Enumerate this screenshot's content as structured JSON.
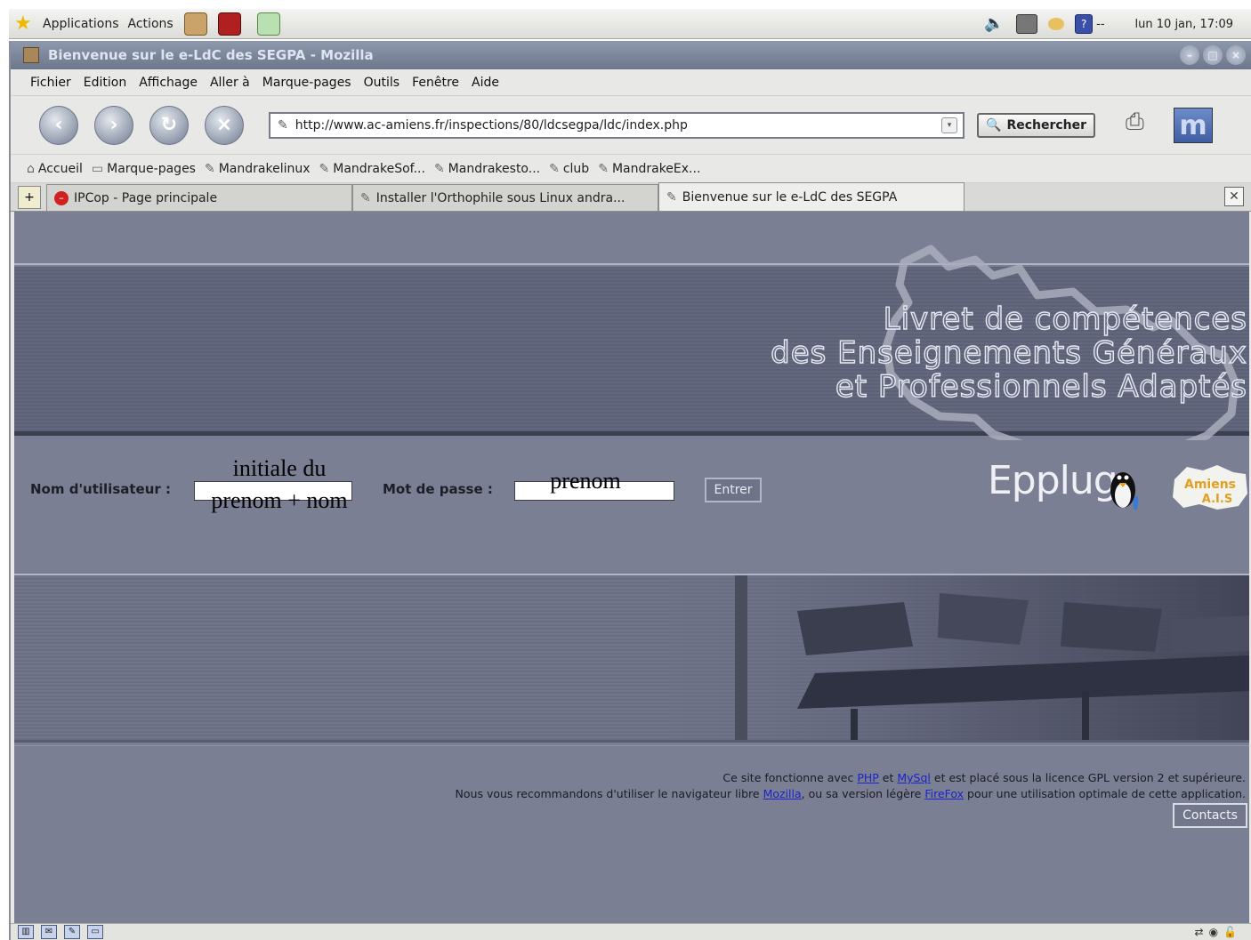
{
  "panel": {
    "menus": [
      "Applications",
      "Actions"
    ],
    "clock": "lun 10 jan, 17:09",
    "network_label": "--"
  },
  "window": {
    "title": "Bienvenue sur le e-LdC des SEGPA - Mozilla"
  },
  "menubar": [
    "Fichier",
    "Edition",
    "Affichage",
    "Aller à",
    "Marque-pages",
    "Outils",
    "Fenêtre",
    "Aide"
  ],
  "navbar": {
    "url": "http://www.ac-amiens.fr/inspections/80/ldcsegpa/ldc/index.php",
    "search_label": "Rechercher"
  },
  "bookmarks": [
    "Accueil",
    "Marque-pages",
    "Mandrakelinux",
    "MandrakeSof...",
    "Mandrakesto...",
    "club",
    "MandrakeEx..."
  ],
  "tabs": [
    {
      "label": "IPCop - Page principale"
    },
    {
      "label": "Installer l'Orthophile sous Linux andra..."
    },
    {
      "label": "Bienvenue sur le e-LdC des SEGPA"
    }
  ],
  "page": {
    "banner_lines": [
      "Livret de compétences",
      "des Enseignements Généraux",
      "et Professionnels Adaptés"
    ],
    "login": {
      "user_label": "Nom d'utilisateur :",
      "pass_label": "Mot de passe :",
      "submit_label": "Entrer",
      "user_annotation_1": "initiale du",
      "user_annotation_2": "prenom + nom",
      "pass_annotation": "prenom"
    },
    "logos": {
      "epplug": "Epplug",
      "amiens_1": "Amiens",
      "amiens_2": "A.I.S"
    },
    "footer": {
      "line1_pre": "Ce site fonctionne avec ",
      "php": "PHP",
      "et": " et ",
      "mysql": "MySql",
      "line1_post": " et est placé sous la licence GPL version 2 et supérieure.",
      "line2_pre": "Nous vous recommandons d'utiliser le navigateur libre ",
      "mozilla": "Mozilla",
      "line2_mid": ", ou sa version légère ",
      "firefox": "FireFox",
      "line2_post": " pour une utilisation optimale de cette application.",
      "contacts": "Contacts"
    }
  },
  "colors": {
    "page_bg": "#7b7f93",
    "banner_dark": "#5d6176",
    "link": "#1a24c8",
    "titlebar": "#7a859a"
  }
}
